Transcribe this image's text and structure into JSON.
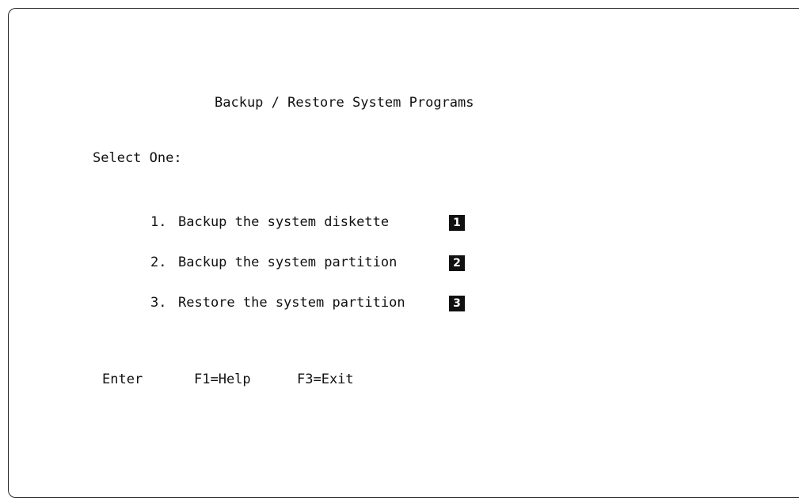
{
  "screen": {
    "title": "Backup / Restore System Programs",
    "prompt": "Select One:"
  },
  "menu": {
    "items": [
      {
        "number": "1.",
        "label": "Backup the system diskette",
        "callout": "1"
      },
      {
        "number": "2.",
        "label": "Backup the system partition",
        "callout": "2"
      },
      {
        "number": "3.",
        "label": "Restore the system partition",
        "callout": "3"
      }
    ]
  },
  "function_keys": {
    "enter": "Enter",
    "help": "F1=Help",
    "exit": "F3=Exit"
  },
  "colors": {
    "background": "#ffffff",
    "text": "#111111",
    "callout_bg": "#111111",
    "callout_text": "#ffffff"
  }
}
